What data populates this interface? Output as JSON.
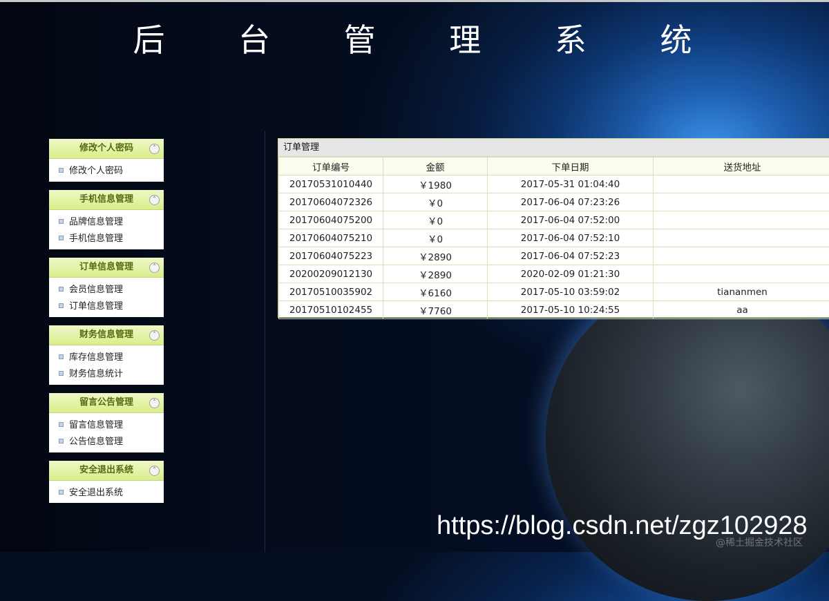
{
  "header": {
    "title": "后 台 管 理 系 统"
  },
  "sidebar": {
    "groups": [
      {
        "title": "修改个人密码",
        "items": [
          "修改个人密码"
        ]
      },
      {
        "title": "手机信息管理",
        "items": [
          "品牌信息管理",
          "手机信息管理"
        ]
      },
      {
        "title": "订单信息管理",
        "items": [
          "会员信息管理",
          "订单信息管理"
        ]
      },
      {
        "title": "财务信息管理",
        "items": [
          "库存信息管理",
          "财务信息统计"
        ]
      },
      {
        "title": "留言公告管理",
        "items": [
          "留言信息管理",
          "公告信息管理"
        ]
      },
      {
        "title": "安全退出系统",
        "items": [
          "安全退出系统"
        ]
      }
    ]
  },
  "main": {
    "panel_title": "订单管理",
    "columns": [
      "订单编号",
      "金额",
      "下单日期",
      "送货地址"
    ],
    "rows": [
      [
        "20170531010440",
        "￥1980",
        "2017-05-31 01:04:40",
        ""
      ],
      [
        "20170604072326",
        "￥0",
        "2017-06-04 07:23:26",
        ""
      ],
      [
        "20170604075200",
        "￥0",
        "2017-06-04 07:52:00",
        ""
      ],
      [
        "20170604075210",
        "￥0",
        "2017-06-04 07:52:10",
        ""
      ],
      [
        "20170604075223",
        "￥2890",
        "2017-06-04 07:52:23",
        ""
      ],
      [
        "20200209012130",
        "￥2890",
        "2020-02-09 01:21:30",
        ""
      ],
      [
        "20170510035902",
        "￥6160",
        "2017-05-10 03:59:02",
        "tiananmen"
      ],
      [
        "20170510102455",
        "￥7760",
        "2017-05-10 10:24:55",
        "aa"
      ]
    ]
  },
  "watermark": {
    "url": "https://blog.csdn.net/zgz102928",
    "sub": "@稀土掘金技术社区"
  },
  "icons": {
    "collapse": "chevron-double-up-icon",
    "bullet": "square-bullet-icon"
  },
  "colors": {
    "menu_header_top": "#eef8c6",
    "menu_header_bottom": "#d9ee8c",
    "menu_header_text": "#556b10",
    "table_border": "#d7e0b8"
  }
}
